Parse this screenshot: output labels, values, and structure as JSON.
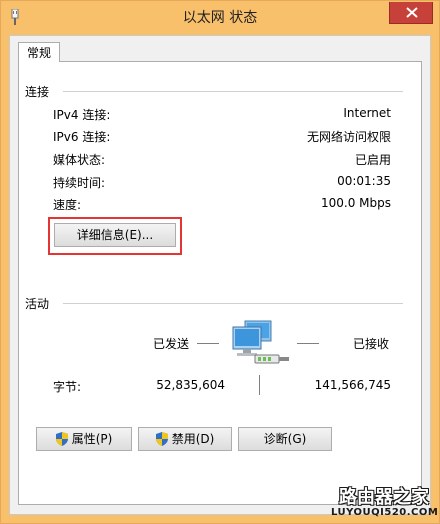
{
  "window": {
    "title": "以太网 状态"
  },
  "tabs": [
    {
      "label": "常规"
    }
  ],
  "connection": {
    "label": "连接",
    "rows": [
      {
        "key": "IPv4 连接:",
        "value": "Internet"
      },
      {
        "key": "IPv6 连接:",
        "value": "无网络访问权限"
      },
      {
        "key": "媒体状态:",
        "value": "已启用"
      },
      {
        "key": "持续时间:",
        "value": "00:01:35"
      },
      {
        "key": "速度:",
        "value": "100.0 Mbps"
      }
    ],
    "details_button": "详细信息(E)..."
  },
  "activity": {
    "label": "活动",
    "sent_label": "已发送",
    "received_label": "已接收",
    "bytes_label": "字节:",
    "bytes_sent": "52,835,604",
    "bytes_received": "141,566,745"
  },
  "buttons": {
    "properties": "属性(P)",
    "disable": "禁用(D)",
    "diagnose": "诊断(G)"
  },
  "watermark": {
    "main": "路由器之家",
    "sub": "LUYOUQI520.COM"
  },
  "colors": {
    "highlight": "#e23534",
    "titlebar": "#f9c06b",
    "close": "#c7413b"
  }
}
